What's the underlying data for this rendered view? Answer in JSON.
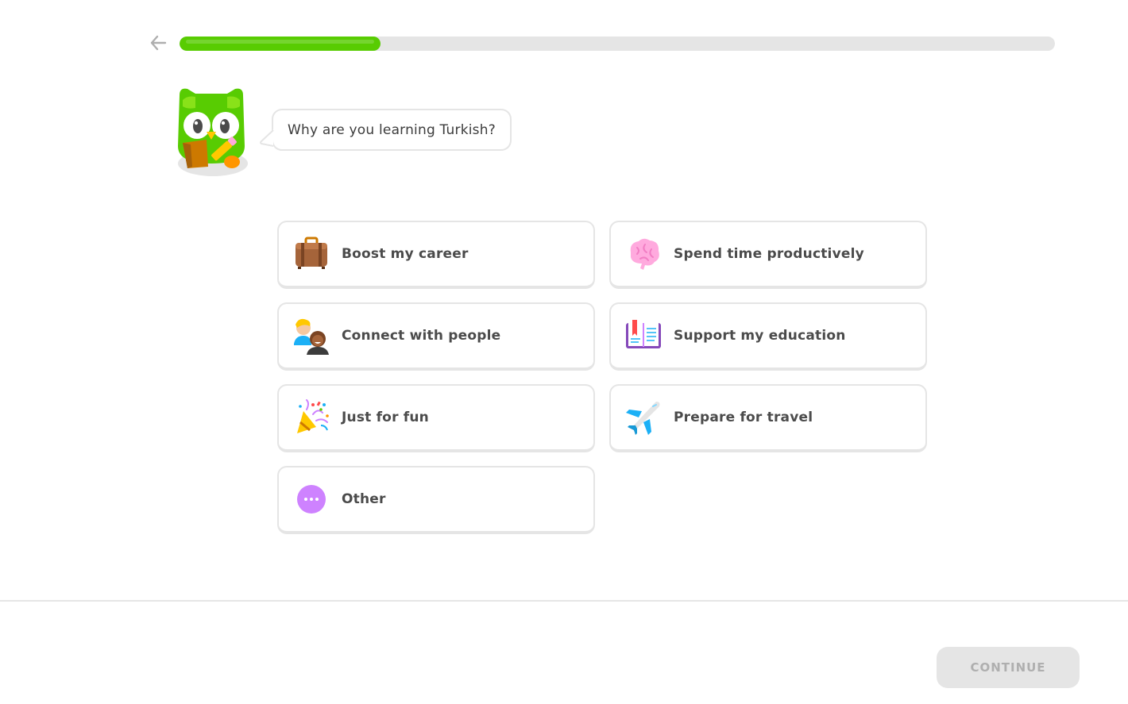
{
  "header": {
    "back_icon": "arrow-left-icon",
    "progress_fraction": 0.23
  },
  "prompt": {
    "mascot": "owl-mascot",
    "question": "Why are you learning Turkish?"
  },
  "options": [
    {
      "label": "Boost my career",
      "icon": "briefcase-icon"
    },
    {
      "label": "Spend time productively",
      "icon": "brain-icon"
    },
    {
      "label": "Connect with people",
      "icon": "people-icon"
    },
    {
      "label": "Support my education",
      "icon": "open-book-icon"
    },
    {
      "label": "Just for fun",
      "icon": "party-popper-icon"
    },
    {
      "label": "Prepare for travel",
      "icon": "airplane-icon"
    },
    {
      "label": "Other",
      "icon": "more-dots-icon"
    }
  ],
  "footer": {
    "continue_label": "CONTINUE"
  },
  "colors": {
    "progress": "#58cc02",
    "track": "#e5e5e5",
    "border": "#e5e5e5",
    "text": "#4b4b4b",
    "disabled_button": "#e5e5e5",
    "disabled_text": "#afafaf"
  }
}
